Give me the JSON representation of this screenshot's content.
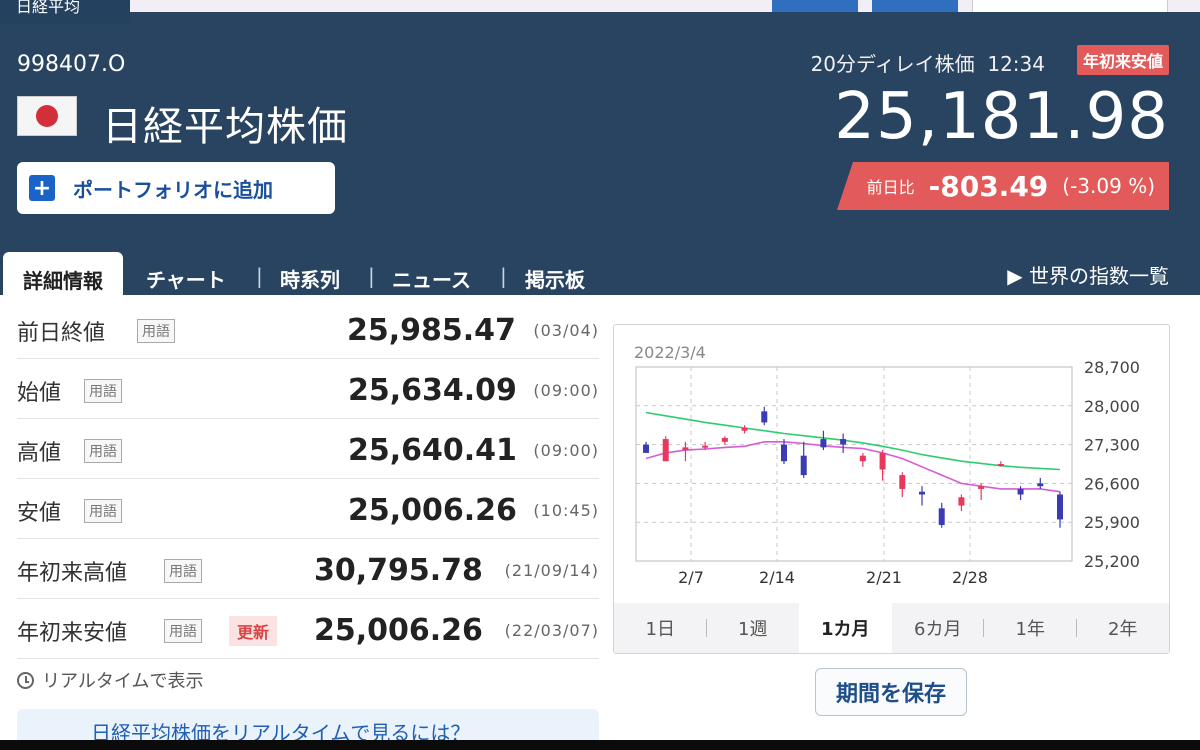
{
  "top": {
    "tab_fragment": "日経平均"
  },
  "header": {
    "code": "998407.O",
    "name": "日経平均株価",
    "portfolio_label": "ポートフォリオに追加",
    "delay_text": "20分ディレイ株価",
    "time": "12:34",
    "badge": "年初来安値",
    "price": "25,181.98",
    "change_label": "前日比",
    "change_value": "-803.49",
    "change_pct": "(-3.09 %)"
  },
  "tabs": {
    "active": "詳細情報",
    "items": [
      "チャート",
      "時系列",
      "ニュース",
      "掲示板"
    ],
    "world_list": "世界の指数一覧"
  },
  "details": {
    "term_label": "用語",
    "update_badge": "更新",
    "rows": [
      {
        "label": "前日終値",
        "value": "25,985.47",
        "when": "(03/04)"
      },
      {
        "label": "始値",
        "value": "25,634.09",
        "when": "(09:00)"
      },
      {
        "label": "高値",
        "value": "25,640.41",
        "when": "(09:00)"
      },
      {
        "label": "安値",
        "value": "25,006.26",
        "when": "(10:45)"
      },
      {
        "label": "年初来高値",
        "value": "30,795.78",
        "when": "(21/09/14)"
      },
      {
        "label": "年初来安値",
        "value": "25,006.26",
        "when": "(22/03/07)"
      }
    ],
    "realtime_label": "リアルタイムで表示",
    "realtime_link": "日経平均株価をリアルタイムで見るには？"
  },
  "chart": {
    "date": "2022/3/4",
    "periods": [
      "1日",
      "1週",
      "1カ月",
      "6カ月",
      "1年",
      "2年"
    ],
    "active_period": "1カ月",
    "save_label": "期間を保存"
  },
  "chart_data": {
    "type": "candlestick",
    "title": "",
    "yticks": [
      "28,700",
      "28,000",
      "27,300",
      "26,600",
      "25,900",
      "25,200"
    ],
    "xticks": [
      "2/7",
      "2/14",
      "2/21",
      "2/28"
    ],
    "ylim": [
      25200,
      28700
    ],
    "grid": true,
    "colors": {
      "up": "#e8385c",
      "down": "#3b3bb3",
      "ma_long": "#2ecc71",
      "ma_short": "#d65bd6"
    },
    "candles": [
      {
        "date": "2/3",
        "open": 27300,
        "high": 27350,
        "low": 27150,
        "close": 27150
      },
      {
        "date": "2/4",
        "open": 27000,
        "high": 27450,
        "low": 27000,
        "close": 27400
      },
      {
        "date": "2/7",
        "open": 27200,
        "high": 27350,
        "low": 27000,
        "close": 27250
      },
      {
        "date": "2/8",
        "open": 27250,
        "high": 27350,
        "low": 27200,
        "close": 27280
      },
      {
        "date": "2/9",
        "open": 27350,
        "high": 27450,
        "low": 27300,
        "close": 27420
      },
      {
        "date": "2/10",
        "open": 27550,
        "high": 27650,
        "low": 27500,
        "close": 27600
      },
      {
        "date": "2/14",
        "open": 27900,
        "high": 27980,
        "low": 27650,
        "close": 27700
      },
      {
        "date": "2/15",
        "open": 27300,
        "high": 27400,
        "low": 26950,
        "close": 27000
      },
      {
        "date": "2/16",
        "open": 27100,
        "high": 27350,
        "low": 26700,
        "close": 26750
      },
      {
        "date": "2/17",
        "open": 27400,
        "high": 27550,
        "low": 27200,
        "close": 27250
      },
      {
        "date": "2/18",
        "open": 27400,
        "high": 27500,
        "low": 27150,
        "close": 27300
      },
      {
        "date": "2/21",
        "open": 27000,
        "high": 27150,
        "low": 26900,
        "close": 27100
      },
      {
        "date": "2/22",
        "open": 26850,
        "high": 27200,
        "low": 26650,
        "close": 27150
      },
      {
        "date": "2/24",
        "open": 26500,
        "high": 26800,
        "low": 26350,
        "close": 26750
      },
      {
        "date": "2/25",
        "open": 26450,
        "high": 26550,
        "low": 26200,
        "close": 26400
      },
      {
        "date": "2/28",
        "open": 26150,
        "high": 26250,
        "low": 25800,
        "close": 25850
      },
      {
        "date": "3/1",
        "open": 26200,
        "high": 26400,
        "low": 26100,
        "close": 26350
      },
      {
        "date": "3/2",
        "open": 26500,
        "high": 26600,
        "low": 26300,
        "close": 26550
      },
      {
        "date": "3/3",
        "open": 26950,
        "high": 27000,
        "low": 26900,
        "close": 26950
      },
      {
        "date": "3/4",
        "open": 26500,
        "high": 26550,
        "low": 26300,
        "close": 26400
      },
      {
        "date": "3/4b",
        "open": 26600,
        "high": 26700,
        "low": 26500,
        "close": 26550
      },
      {
        "date": "3/7",
        "open": 26400,
        "high": 26450,
        "low": 25800,
        "close": 25950
      }
    ],
    "ma_long": [
      27880,
      27820,
      27760,
      27700,
      27650,
      27600,
      27550,
      27500,
      27460,
      27420,
      27380,
      27330,
      27270,
      27200,
      27120,
      27060,
      27000,
      26960,
      26920,
      26890,
      26870,
      26850
    ],
    "ma_short": [
      27050,
      27150,
      27200,
      27220,
      27250,
      27270,
      27350,
      27350,
      27320,
      27280,
      27250,
      27230,
      27150,
      27050,
      26900,
      26750,
      26600,
      26550,
      26500,
      26500,
      26500,
      26450
    ]
  }
}
